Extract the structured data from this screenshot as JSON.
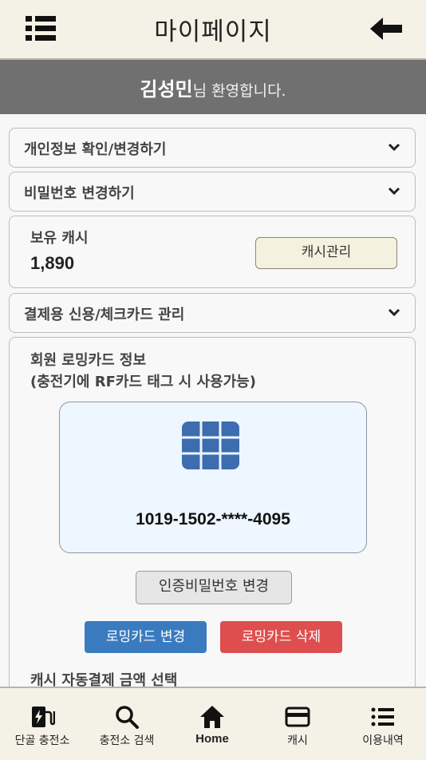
{
  "header": {
    "title": "마이페이지",
    "menu_icon": "list-menu-icon",
    "back_icon": "arrow-left-icon"
  },
  "welcome": {
    "name": "김성민",
    "message": "님 환영합니다."
  },
  "sections": {
    "personal_info": "개인정보 확인/변경하기",
    "password_change": "비밀번호 변경하기",
    "payment_cards": "결제용 신용/체크카드 관리"
  },
  "cash": {
    "label": "보유 캐시",
    "value": "1,890",
    "manage_button": "캐시관리"
  },
  "roaming": {
    "title_line1": "회원 로밍카드 정보",
    "title_line2": "(충전기에 RF카드 태그 시 사용가능)",
    "card_number": "1019-1502-****-4095",
    "pin_button": "인증비밀번호 변경",
    "change_button": "로밍카드 변경",
    "delete_button": "로밍카드 삭제"
  },
  "auto_pay_title": "캐시 자동결제 금액 선택",
  "bottom_nav": [
    {
      "label": "단골 충전소",
      "icon": "charger-icon"
    },
    {
      "label": "충전소 검색",
      "icon": "search-icon"
    },
    {
      "label": "Home",
      "icon": "home-icon"
    },
    {
      "label": "캐시",
      "icon": "credit-card-icon"
    },
    {
      "label": "이용내역",
      "icon": "list-icon"
    }
  ],
  "colors": {
    "topbar_bg": "#f4f1e6",
    "welcome_bg": "#707070",
    "change_button": "#3a7bc0",
    "delete_button": "#df4e4e",
    "chip_blue": "#3d6db0",
    "card_bg": "#eef6ff"
  }
}
